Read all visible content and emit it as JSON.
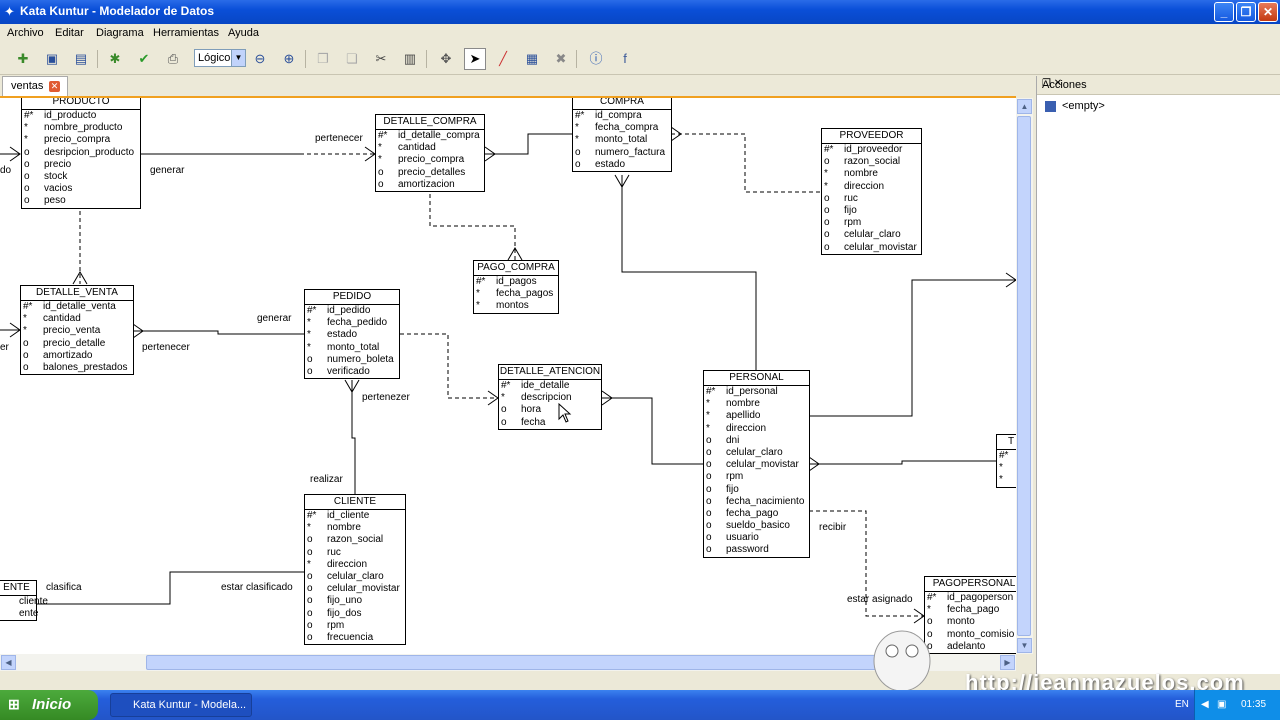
{
  "window": {
    "title": "Kata Kuntur - Modelador de Datos",
    "minimize": "_",
    "maximize": "❐",
    "close": "✕"
  },
  "menu": [
    "Archivo",
    "Editar",
    "Diagrama",
    "Herramientas",
    "Ayuda"
  ],
  "toolbar": {
    "view_select": "Lógico"
  },
  "tabs": [
    {
      "label": "ventas",
      "close": "✕"
    }
  ],
  "actions_panel": {
    "title": "Acciones",
    "item": "<empty>"
  },
  "entities": {
    "producto": {
      "name": "PRODUCTO",
      "rows": [
        [
          "#*",
          "id_producto"
        ],
        [
          "*",
          "nombre_producto"
        ],
        [
          "*",
          "precio_compra"
        ],
        [
          "o",
          "desripcion_producto"
        ],
        [
          "o",
          "precio"
        ],
        [
          "o",
          "stock"
        ],
        [
          "o",
          "vacios"
        ],
        [
          "o",
          "peso"
        ]
      ]
    },
    "detalle_compra": {
      "name": "DETALLE_COMPRA",
      "rows": [
        [
          "#*",
          "id_detalle_compra"
        ],
        [
          "*",
          "cantidad"
        ],
        [
          "*",
          "precio_compra"
        ],
        [
          "o",
          "precio_detalles"
        ],
        [
          "o",
          "amortizacion"
        ]
      ]
    },
    "compra": {
      "name": "COMPRA",
      "rows": [
        [
          "#*",
          "id_compra"
        ],
        [
          "*",
          "fecha_compra"
        ],
        [
          "*",
          "monto_total"
        ],
        [
          "o",
          "numero_factura"
        ],
        [
          "o",
          "estado"
        ]
      ]
    },
    "proveedor": {
      "name": "PROVEEDOR",
      "rows": [
        [
          "#*",
          "id_proveedor"
        ],
        [
          "o",
          "razon_social"
        ],
        [
          "*",
          "nombre"
        ],
        [
          "*",
          "direccion"
        ],
        [
          "o",
          "ruc"
        ],
        [
          "o",
          "fijo"
        ],
        [
          "o",
          "rpm"
        ],
        [
          "o",
          "celular_claro"
        ],
        [
          "o",
          "celular_movistar"
        ]
      ]
    },
    "pago_compra": {
      "name": "PAGO_COMPRA",
      "rows": [
        [
          "#*",
          "id_pagos"
        ],
        [
          "*",
          "fecha_pagos"
        ],
        [
          "*",
          "montos"
        ]
      ]
    },
    "detalle_venta": {
      "name": "DETALLE_VENTA",
      "rows": [
        [
          "#*",
          "id_detalle_venta"
        ],
        [
          "*",
          "cantidad"
        ],
        [
          "*",
          "precio_venta"
        ],
        [
          "o",
          "precio_detalle"
        ],
        [
          "o",
          "amortizado"
        ],
        [
          "o",
          "balones_prestados"
        ]
      ]
    },
    "pedido": {
      "name": "PEDIDO",
      "rows": [
        [
          "#*",
          "id_pedido"
        ],
        [
          "*",
          "fecha_pedido"
        ],
        [
          "*",
          "estado"
        ],
        [
          "*",
          "monto_total"
        ],
        [
          "o",
          "numero_boleta"
        ],
        [
          "o",
          "verificado"
        ]
      ]
    },
    "detalle_atencion": {
      "name": "DETALLE_ATENCION",
      "rows": [
        [
          "#*",
          "ide_detalle"
        ],
        [
          "*",
          "descripcion"
        ],
        [
          "o",
          "hora"
        ],
        [
          "o",
          "fecha"
        ]
      ]
    },
    "personal": {
      "name": "PERSONAL",
      "rows": [
        [
          "#*",
          "id_personal"
        ],
        [
          "*",
          "nombre"
        ],
        [
          "*",
          "apellido"
        ],
        [
          "*",
          "direccion"
        ],
        [
          "o",
          "dni"
        ],
        [
          "o",
          "celular_claro"
        ],
        [
          "o",
          "celular_movistar"
        ],
        [
          "o",
          "rpm"
        ],
        [
          "o",
          "fijo"
        ],
        [
          "o",
          "fecha_nacimiento"
        ],
        [
          "o",
          "fecha_pago"
        ],
        [
          "o",
          "sueldo_basico"
        ],
        [
          "o",
          "usuario"
        ],
        [
          "o",
          "password"
        ]
      ]
    },
    "cliente": {
      "name": "CLIENTE",
      "rows": [
        [
          "#*",
          "id_cliente"
        ],
        [
          "*",
          "nombre"
        ],
        [
          "o",
          "razon_social"
        ],
        [
          "o",
          "ruc"
        ],
        [
          "*",
          "direccion"
        ],
        [
          "o",
          "celular_claro"
        ],
        [
          "o",
          "celular_movistar"
        ],
        [
          "o",
          "fijo_uno"
        ],
        [
          "o",
          "fijo_dos"
        ],
        [
          "o",
          "rpm"
        ],
        [
          "o",
          "frecuencia"
        ]
      ]
    },
    "pagopersonal": {
      "name": "PAGOPERSONAL",
      "rows": [
        [
          "#*",
          "id_pagoperson"
        ],
        [
          "*",
          "fecha_pago"
        ],
        [
          "o",
          "monto"
        ],
        [
          "o",
          "monto_comisio"
        ],
        [
          "o",
          "adelanto"
        ]
      ]
    },
    "cliente_tipo": {
      "name": "ENTE",
      "rows": [
        [
          "",
          "cliente"
        ],
        [
          "",
          "ente"
        ]
      ]
    },
    "t_entity": {
      "name": "T",
      "rows": [
        [
          "#*",
          ""
        ],
        [
          "*",
          ""
        ],
        [
          "*",
          ""
        ]
      ]
    }
  },
  "relations": {
    "pertenecer1": "pertenecer",
    "generar1": "generar",
    "generar2": "generar",
    "pertenecer2": "pertenecer",
    "pertenezer": "pertenezer",
    "realizar": "realizar",
    "clasifica": "clasifica",
    "estar_clasificado": "estar clasificado",
    "recibir": "recibir",
    "estar_asignado": "estar asignado",
    "cut_left1": "do",
    "cut_left2": "er"
  },
  "watermark": "http://jeanmazuelos.com",
  "taskbar": {
    "start": "Inicio",
    "task": "Kata Kuntur - Modela...",
    "lang": "EN",
    "time": "01:35"
  }
}
